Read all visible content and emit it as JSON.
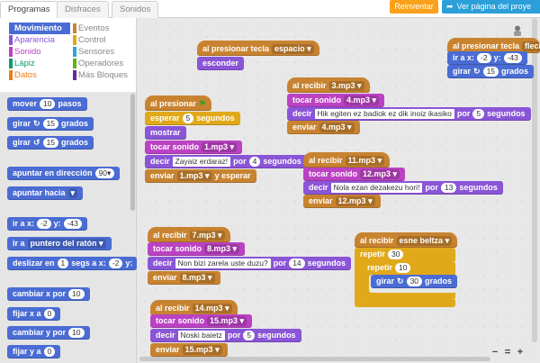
{
  "tabs": [
    "Programas",
    "Disfraces",
    "Sonidos"
  ],
  "buttons": {
    "reinventar": "Reinventar",
    "ver_pagina": "Ver página del proye"
  },
  "categories": {
    "left": [
      {
        "label": "Movimiento",
        "color": "#4a6cd4",
        "selected": true
      },
      {
        "label": "Apariencia",
        "color": "#8a55d7"
      },
      {
        "label": "Sonido",
        "color": "#bb42c3"
      },
      {
        "label": "Lápiz",
        "color": "#0e9a6c"
      },
      {
        "label": "Datos",
        "color": "#ee7d16"
      }
    ],
    "right": [
      {
        "label": "Eventos",
        "color": "#c88330"
      },
      {
        "label": "Control",
        "color": "#e1a91a"
      },
      {
        "label": "Sensores",
        "color": "#2ca5e2"
      },
      {
        "label": "Operadores",
        "color": "#5cb712"
      },
      {
        "label": "Más Bloques",
        "color": "#632d99"
      }
    ]
  },
  "palette": {
    "mover": "mover",
    "mover_v": "10",
    "pasos": "pasos",
    "girar": "girar",
    "girar_r_v": "15",
    "grados": "grados",
    "girar_l_v": "15",
    "apuntar_dir": "apuntar en dirección",
    "dir_v": "90▾",
    "apuntar_hacia": "apuntar hacia",
    "ir_a": "ir a x:",
    "ir_x": "-2",
    "y": "y:",
    "ir_y": "-43",
    "ir_a2": "ir a",
    "puntero": "puntero del ratón",
    "deslizar": "deslizar en",
    "desl_v": "1",
    "segs_a": "segs a x:",
    "desl_x": "-2",
    "desl_y_label": "y:",
    "cambiar_x": "cambiar x por",
    "cambiar_x_v": "10",
    "fijar_x": "fijar x a",
    "fijar_x_v": "0",
    "cambiar_y": "cambiar y por",
    "cambiar_y_v": "10",
    "fijar_y": "fijar y a",
    "fijar_y_v": "0"
  },
  "scripts": {
    "al_presionar_tecla": "al presionar tecla",
    "espacio": "espacio",
    "esconder": "esconder",
    "al_presionar": "al presionar",
    "esperar": "esperar",
    "esperar_v": "5",
    "segundos": "segundos",
    "mostrar": "mostrar",
    "tocar_sonido": "tocar sonido",
    "s1": "1.mp3",
    "decir": "decir",
    "zayaiz": "Zayaiz erdaraz!",
    "por": "por",
    "decir_v4": "4",
    "enviar": "enviar",
    "y_esperar": "y esperar",
    "al_recibir": "al recibir",
    "m3": "3.mp3",
    "m4": "4.mp3",
    "hik": "Hik egiten ez badiok ez dik inoiz ikasiko",
    "hik_v": "5",
    "m11": "11.mp3",
    "m12": "12.mp3",
    "nola": "Nola ezan dezakezu hori!",
    "nola_v": "13",
    "m7": "7.mp3",
    "m8": "8.mp3",
    "non": "Non bizi zarela uste duzu?",
    "non_v": "14",
    "m14": "14.mp3",
    "m15": "15.mp3",
    "noski": "Noski baietz",
    "noski_v": "5",
    "esne": "esne beltza",
    "repetir": "repetir",
    "rep_outer": "30",
    "rep_inner": "10",
    "girar": "girar",
    "girar_v": "30",
    "grados": "grados",
    "tr_tecla": "al presionar tecla",
    "tr_flecha": "flech",
    "tr_ira": "ir a x:",
    "tr_x": "-2",
    "tr_y_label": "y:",
    "tr_y": "-43",
    "tr_girar": "girar",
    "tr_girar_v": "15",
    "tr_grados": "grados"
  },
  "zoom": {
    "minus": "−",
    "reset": "=",
    "plus": "+"
  }
}
